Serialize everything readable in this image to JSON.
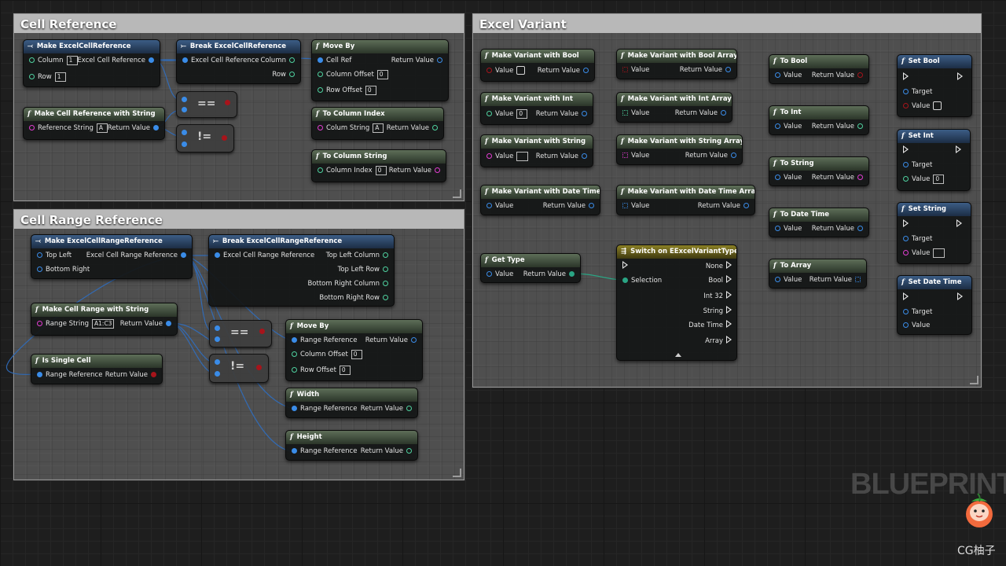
{
  "cell_reference": {
    "title": "Cell Reference",
    "make_ref": {
      "title": "Make ExcelCellReference",
      "column": "Column",
      "column_val": "1",
      "row": "Row",
      "row_val": "1",
      "out": "Excel Cell Reference"
    },
    "break_ref": {
      "title": "Break ExcelCellReference",
      "in": "Excel Cell Reference",
      "column": "Column",
      "row": "Row"
    },
    "move_by": {
      "title": "Move By",
      "cell_ref": "Cell Ref",
      "return": "Return Value",
      "col_off": "Column Offset",
      "col_off_val": "0",
      "row_off": "Row Offset",
      "row_off_val": "0"
    },
    "make_str": {
      "title": "Make Cell Reference with String",
      "ref_str": "Reference String",
      "ref_str_val": "A",
      "return": "Return Value"
    },
    "to_col_index": {
      "title": "To Column Index",
      "col_str": "Colum String",
      "col_str_val": "A",
      "return": "Return Value"
    },
    "to_col_string": {
      "title": "To Column String",
      "col_index": "Column Index",
      "col_index_val": "0",
      "return": "Return Value"
    },
    "eq": "==",
    "neq": "!="
  },
  "cell_range": {
    "title": "Cell Range Reference",
    "make_range": {
      "title": "Make ExcelCellRangeReference",
      "top_left": "Top Left",
      "bottom_right": "Bottom Right",
      "out": "Excel Cell Range Reference"
    },
    "break_range": {
      "title": "Break ExcelCellRangeReference",
      "in": "Excel Cell Range Reference",
      "tlc": "Top Left Column",
      "tlr": "Top Left Row",
      "brc": "Bottom Right Column",
      "brr": "Bottom Right Row"
    },
    "make_range_str": {
      "title": "Make Cell Range with String",
      "range_str": "Range String",
      "range_str_val": "A1:C3",
      "return": "Return Value"
    },
    "is_single": {
      "title": "Is Single Cell",
      "range_ref": "Range Reference",
      "return": "Return Value"
    },
    "move_by": {
      "title": "Move By",
      "range_ref": "Range Reference",
      "return": "Return Value",
      "col_off": "Column Offset",
      "col_off_val": "0",
      "row_off": "Row Offset",
      "row_off_val": "0"
    },
    "width": {
      "title": "Width",
      "range_ref": "Range Reference",
      "return": "Return Value"
    },
    "height": {
      "title": "Height",
      "range_ref": "Range Reference",
      "return": "Return Value"
    },
    "eq": "==",
    "neq": "!="
  },
  "excel_variant": {
    "title": "Excel Variant",
    "mv_bool": {
      "title": "Make Variant with Bool",
      "value": "Value",
      "return": "Return Value"
    },
    "mv_int": {
      "title": "Make Variant with Int",
      "value": "Value",
      "value_val": "0",
      "return": "Return Value"
    },
    "mv_string": {
      "title": "Make Variant with String",
      "value": "Value",
      "return": "Return Value"
    },
    "mv_date": {
      "title": "Make Variant with Date Time",
      "value": "Value",
      "return": "Return Value"
    },
    "mv_bool_arr": {
      "title": "Make Variant with Bool Array",
      "value": "Value",
      "return": "Return Value"
    },
    "mv_int_arr": {
      "title": "Make Variant with Int Array",
      "value": "Value",
      "return": "Return Value"
    },
    "mv_string_arr": {
      "title": "Make Variant with String Array",
      "value": "Value",
      "return": "Return Value"
    },
    "mv_date_arr": {
      "title": "Make Variant with Date Time Array",
      "value": "Value",
      "return": "Return Value"
    },
    "get_type": {
      "title": "Get Type",
      "value": "Value",
      "return": "Return Value"
    },
    "switch": {
      "title": "Switch on EExcelVariantType",
      "selection": "Selection",
      "outs": [
        "None",
        "Bool",
        "Int 32",
        "String",
        "Date Time",
        "Array"
      ]
    },
    "to_bool": {
      "title": "To Bool",
      "value": "Value",
      "return": "Return Value"
    },
    "to_int": {
      "title": "To Int",
      "value": "Value",
      "return": "Return Value"
    },
    "to_string": {
      "title": "To String",
      "value": "Value",
      "return": "Return Value"
    },
    "to_date": {
      "title": "To Date Time",
      "value": "Value",
      "return": "Return Value"
    },
    "to_array": {
      "title": "To Array",
      "value": "Value",
      "return": "Return Value"
    },
    "set_bool": {
      "title": "Set Bool",
      "target": "Target",
      "value": "Value"
    },
    "set_int": {
      "title": "Set Int",
      "target": "Target",
      "value": "Value",
      "value_val": "0"
    },
    "set_string": {
      "title": "Set String",
      "target": "Target",
      "value": "Value"
    },
    "set_date": {
      "title": "Set Date Time",
      "target": "Target",
      "value": "Value"
    }
  },
  "watermark": "BLUEPRINT",
  "logo_text": "CG柚子",
  "colors": {
    "struct_pin": "#3a8ce8",
    "int_pin": "#4fd2a0",
    "string_pin": "#e23ed2",
    "bool_pin": "#a7141b",
    "enum_pin": "#2aa584"
  }
}
